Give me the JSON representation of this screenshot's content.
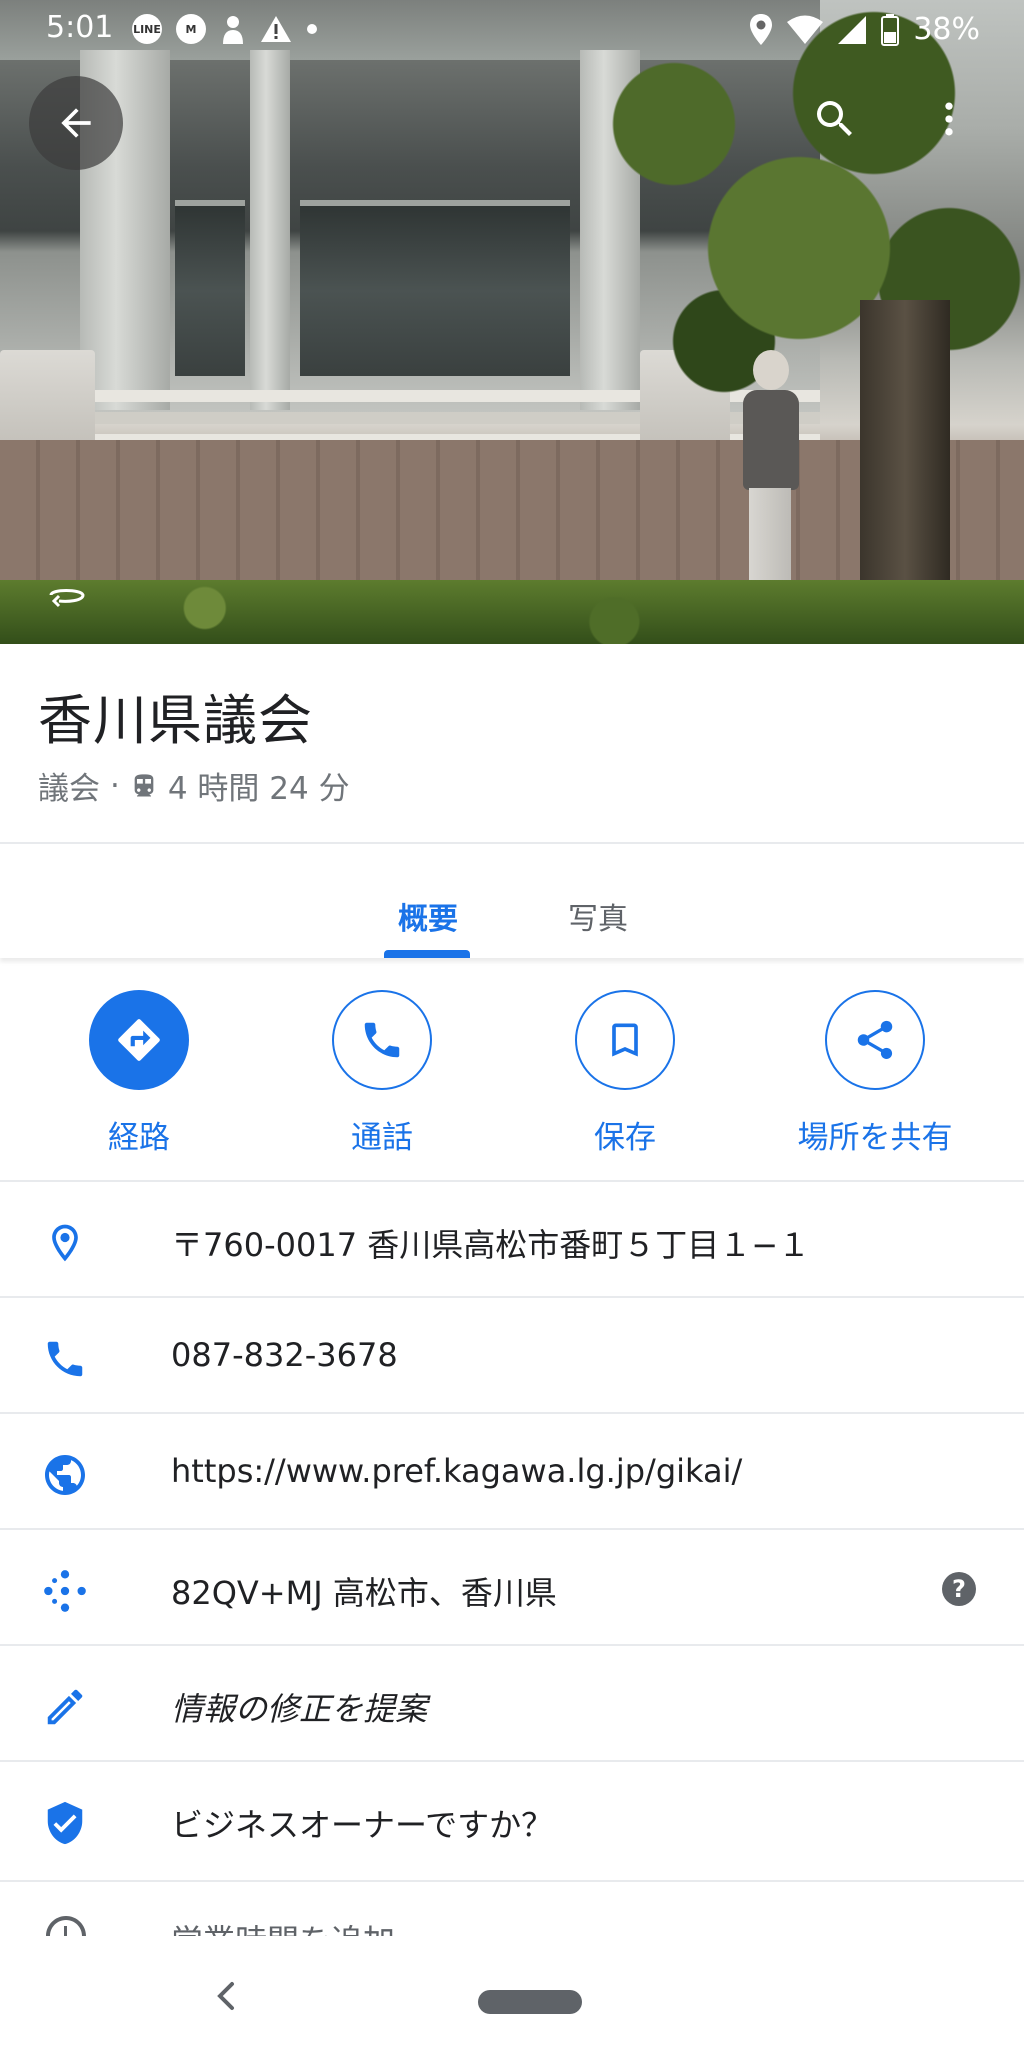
{
  "status_bar": {
    "time": "5:01",
    "battery": "38%",
    "left_icons": [
      "line-icon",
      "m-icon",
      "person-icon",
      "warning-icon",
      "dot-icon"
    ],
    "right_icons": [
      "location-icon",
      "wifi-icon",
      "signal-icon",
      "battery-icon"
    ]
  },
  "place": {
    "name": "香川県議会",
    "category": "議会",
    "separator": "·",
    "transit_time": "4 時間 24 分"
  },
  "tabs": [
    {
      "label": "概要",
      "active": true
    },
    {
      "label": "写真",
      "active": false
    }
  ],
  "actions": [
    {
      "label": "経路",
      "icon": "directions-icon"
    },
    {
      "label": "通話",
      "icon": "phone-icon"
    },
    {
      "label": "保存",
      "icon": "bookmark-icon"
    },
    {
      "label": "場所を共有",
      "icon": "share-icon"
    }
  ],
  "info_rows": [
    {
      "icon": "location-pin-icon",
      "text": "〒760-0017 香川県高松市番町５丁目１−１"
    },
    {
      "icon": "phone-icon",
      "text": "087-832-3678"
    },
    {
      "icon": "globe-icon",
      "text": "https://www.pref.kagawa.lg.jp/gikai/"
    },
    {
      "icon": "plus-code-icon",
      "text": "82QV+MJ 高松市、香川県",
      "help": "?"
    },
    {
      "icon": "pencil-icon",
      "text": "情報の修正を提案"
    },
    {
      "icon": "verified-shield-icon",
      "text": "ビジネスオーナーですか？"
    },
    {
      "icon": "clock-icon",
      "text": "営業時間を追加"
    }
  ],
  "colors": {
    "accent": "#1a73e8",
    "icon_blue": "#1a73e8",
    "text_primary": "#202124",
    "text_secondary": "#70757a"
  }
}
